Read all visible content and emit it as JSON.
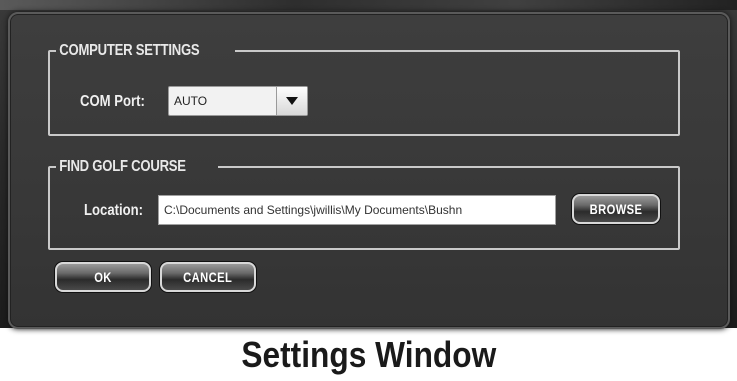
{
  "computer_settings": {
    "legend": "COMPUTER SETTINGS",
    "com_port_label": "COM Port:",
    "com_port_value": "AUTO"
  },
  "find_golf_course": {
    "legend": "FIND GOLF COURSE",
    "location_label": "Location:",
    "location_value": "C:\\Documents and Settings\\jwillis\\My Documents\\Bushn",
    "browse_label": "BROWSE"
  },
  "actions": {
    "ok_label": "OK",
    "cancel_label": "CANCEL"
  },
  "caption": "Settings Window",
  "icons": {
    "dropdown": "chevron-down-icon"
  },
  "colors": {
    "panel": "#3a3a3a",
    "frame": "#c9c9c9",
    "caption_text": "#1a1a1a"
  }
}
